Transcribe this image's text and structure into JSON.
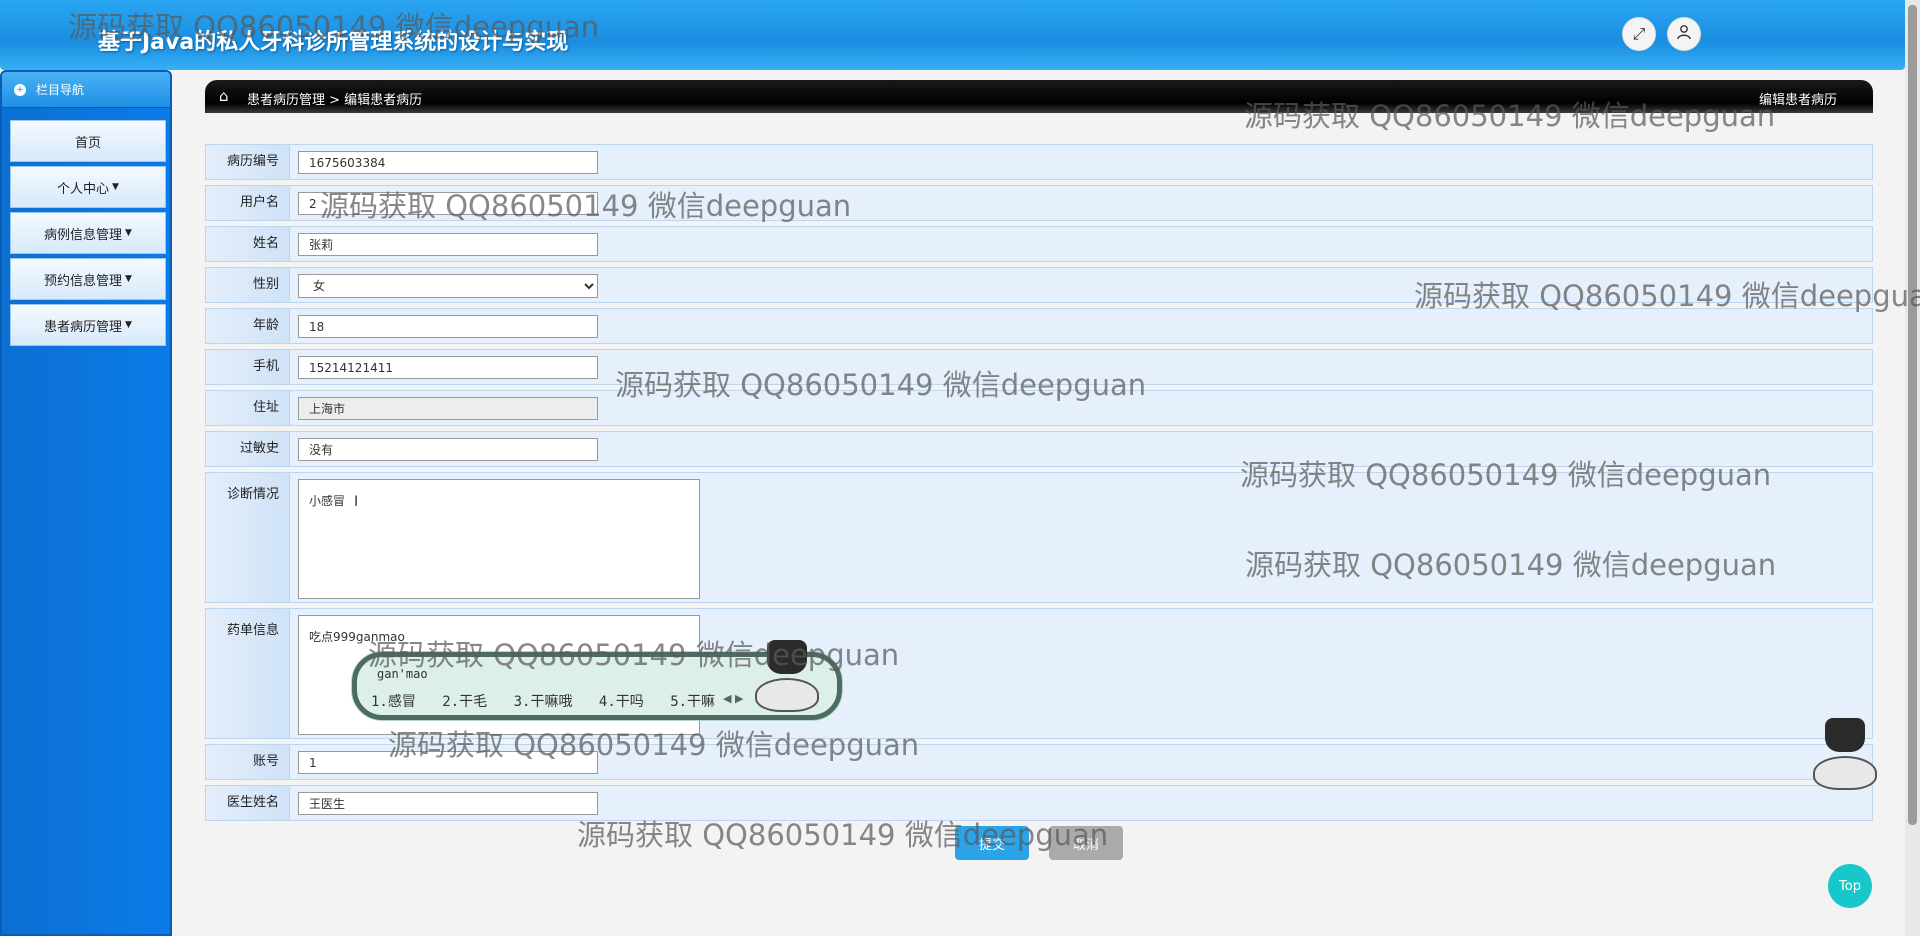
{
  "header": {
    "title": "基于Java的私人牙科诊所管理系统的设计与实现",
    "fullscreen_icon": "expand-icon",
    "user_icon": "user-icon"
  },
  "sidebar": {
    "heading": "栏目导航",
    "items": [
      {
        "label": "首页",
        "has_caret": false
      },
      {
        "label": "个人中心",
        "has_caret": true
      },
      {
        "label": "病例信息管理",
        "has_caret": true
      },
      {
        "label": "预约信息管理",
        "has_caret": true
      },
      {
        "label": "患者病历管理",
        "has_caret": true
      }
    ]
  },
  "breadcrumb": {
    "path": "患者病历管理 > 编辑患者病历",
    "right_title": "编辑患者病历"
  },
  "form": {
    "record_no": {
      "label": "病历编号",
      "value": "1675603384"
    },
    "username": {
      "label": "用户名",
      "value": "2"
    },
    "name": {
      "label": "姓名",
      "value": "张莉"
    },
    "gender": {
      "label": "性别",
      "value": "女"
    },
    "age": {
      "label": "年龄",
      "value": "18"
    },
    "phone": {
      "label": "手机",
      "value": "15214121411"
    },
    "address": {
      "label": "住址",
      "value": "上海市"
    },
    "allergy": {
      "label": "过敏史",
      "value": "没有"
    },
    "diagnosis": {
      "label": "诊断情况",
      "value": "小感冒"
    },
    "prescription": {
      "label": "药单信息",
      "value": "吃点999ganmao"
    },
    "account": {
      "label": "账号",
      "value": "1"
    },
    "doctor_name": {
      "label": "医生姓名",
      "value": "王医生"
    }
  },
  "buttons": {
    "submit": "提交",
    "cancel": "取消",
    "top": "Top"
  },
  "ime": {
    "pinyin": "gan'mao",
    "candidates": [
      "1.感冒",
      "2.干毛",
      "3.干嘛哦",
      "4.干吗",
      "5.干嘛"
    ]
  },
  "watermark": "源码获取 QQ86050149 微信deepguan",
  "colors": {
    "header": "#1a8de0",
    "sidebar": "#0b7be8",
    "row_bg": "#e6f0fc",
    "submit": "#2aa3e8",
    "top_button": "#17c7c9"
  }
}
